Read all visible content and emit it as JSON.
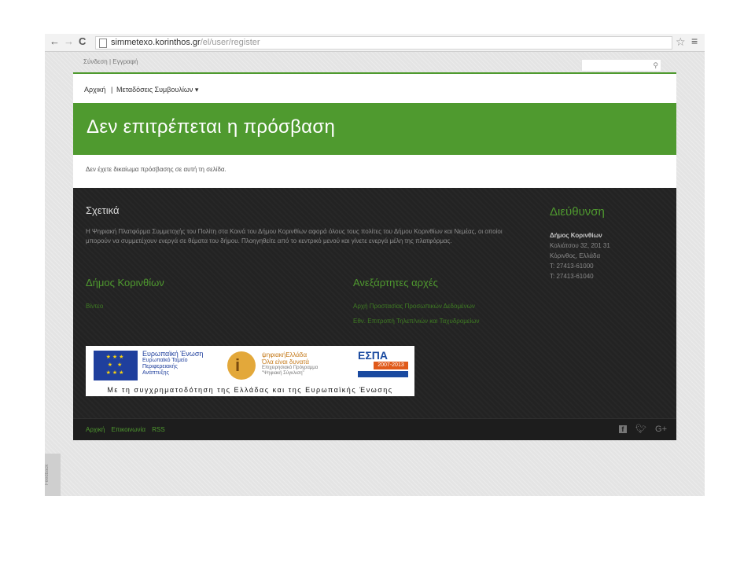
{
  "browser": {
    "back": "←",
    "forward": "→",
    "reload": "C",
    "url_host": "simmetexo.korinthos.gr",
    "url_path": "/el/user/register",
    "star": "☆",
    "menu": "≡"
  },
  "utility": {
    "login": "Σύνδεση",
    "separator": "|",
    "register": "Εγγραφή",
    "search_icon": "search-icon"
  },
  "nav": {
    "home": "Αρχική",
    "separator": "|",
    "broadcasts": "Μεταδόσεις Συμβουλίων ▾"
  },
  "hero": {
    "title": "Δεν επιτρέπεται η πρόσβαση"
  },
  "message": "Δεν έχετε δικαίωμα πρόσβασης σε αυτή τη σελίδα.",
  "footer": {
    "about_title": "Σχετικά",
    "about_text": "Η Ψηφιακή Πλατφόρμα Συμμετοχής του Πολίτη στα Κοινά του Δήμου Κορινθίων αφορά όλους τους πολίτες του Δήμου Κορινθίων και Νεμέας, οι οποίοι μπορούν να συμμετέχουν ενεργά σε θέματα του δήμου. Πλοηγηθείτε από το κεντρικό μενού και γίνετε ενεργά μέλη της πλατφόρμας.",
    "address_title": "Διεύθυνση",
    "address_name": "Δήμος Κορινθίων",
    "address_street": "Κολιάτσου 32, 201 31",
    "address_city": "Κόρινθος, Ελλάδα",
    "phone1": "T: 27413-61000",
    "phone2": "T: 27413-61040",
    "municipality_title": "Δήμος Κορινθίων",
    "municipality_link": "Βίντεο",
    "independent_title": "Ανεξάρτητες αρχές",
    "independent_links": [
      "Αρχή Προστασίας Προσωπικών Δεδομένων",
      "Εθν. Επιτροπή Τηλεπ/νιών και Ταχυδρομείων"
    ],
    "banner": {
      "eu_title": "Ευρωπαϊκή Ένωση",
      "eu_fund_1": "Ευρωπαϊκό Ταμείο",
      "eu_fund_2": "Περιφερειακής",
      "eu_fund_3": "Ανάπτυξης",
      "digital_title": "ψηφιακήΕλλάδα",
      "digital_slogan": "Όλα είναι δυνατά",
      "digital_program_1": "Επιχειρησιακό Πρόγραμμα",
      "digital_program_2": "\"Ψηφιακή Σύγκλιση\"",
      "espa": "ΕΣΠΑ",
      "espa_years": "2007-2013",
      "caption": "Με τη συγχρηματοδότηση της Ελλάδας και της Ευρωπαϊκής Ένωσης"
    },
    "bottom_links": [
      "Αρχική",
      "Επικοινωνία",
      "RSS"
    ],
    "social": [
      "facebook-icon",
      "twitter-icon",
      "google-plus-icon"
    ],
    "social_glyphs": {
      "facebook": "f",
      "twitter": "🐦",
      "gplus": "G+"
    }
  },
  "side_tab": "Feedback",
  "colors": {
    "accent_green": "#4f9a2f",
    "footer_dark": "#232323"
  }
}
